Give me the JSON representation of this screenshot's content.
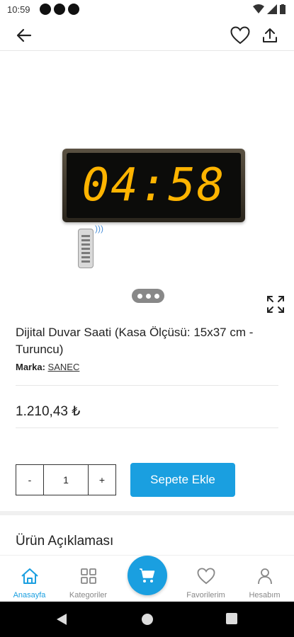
{
  "status_bar": {
    "time": "10:59"
  },
  "product": {
    "display_time": "04:58",
    "title": "Dijital Duvar Saati (Kasa Ölçüsü: 15x37 cm - Turuncu)",
    "brand_label": "Marka:",
    "brand_name": "SANEC",
    "price": "1.210,43 ₺"
  },
  "quantity": {
    "minus": "-",
    "value": "1",
    "plus": "+"
  },
  "add_to_cart_label": "Sepete Ekle",
  "description_title": "Ürün Açıklaması",
  "bottom_nav": {
    "items": [
      {
        "label": "Anasayfa",
        "icon": "home-icon",
        "active": true
      },
      {
        "label": "Kategoriler",
        "icon": "grid-icon",
        "active": false
      },
      {
        "label": "",
        "icon": "cart-icon",
        "active": false
      },
      {
        "label": "Favorilerim",
        "icon": "heart-icon",
        "active": false
      },
      {
        "label": "Hesabım",
        "icon": "user-icon",
        "active": false
      }
    ]
  },
  "colors": {
    "accent": "#1a9fe0",
    "clock_digits": "#ffb400"
  }
}
